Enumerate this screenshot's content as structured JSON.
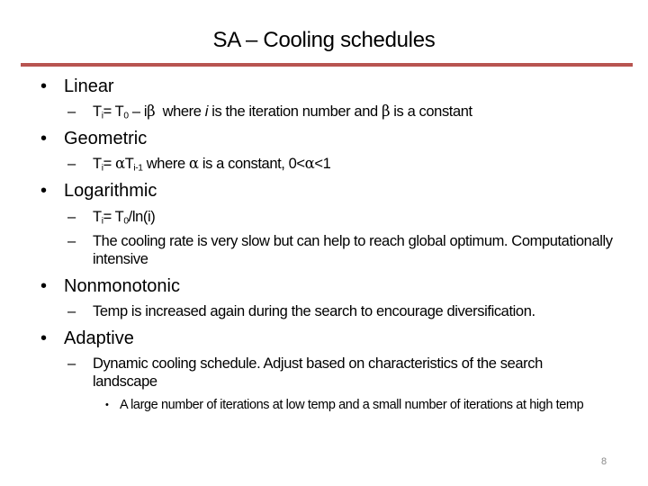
{
  "slide": {
    "title": "SA – Cooling schedules",
    "accent_color": "#b85450",
    "page_number": "8",
    "sections": [
      {
        "heading": "Linear",
        "bullet": "•",
        "items": [
          {
            "dash": "–",
            "formula": {
              "lhs": "T",
              "lhs_sub": "i",
              "eq": "= T",
              "eq_sub": "0",
              "rest": " – i",
              "greek": "β"
            },
            "text_a": "  where ",
            "text_it": "i",
            "text_b": " is the iteration number and ",
            "text_greek": "β",
            "text_c": " is a constant"
          }
        ]
      },
      {
        "heading": "Geometric",
        "bullet": "•",
        "items": [
          {
            "dash": "–",
            "lhs": "T",
            "lhs_sub": "i",
            "eq": "= ",
            "greek": "α",
            "t": "T",
            "t_sub": "i-1",
            "text_a": " where ",
            "text_greek": "α",
            "text_b": " is a constant, 0<",
            "text_greek2": "α",
            "text_c": "<1"
          }
        ]
      },
      {
        "heading": "Logarithmic",
        "bullet": "•",
        "items": [
          {
            "dash": "–",
            "lhs": "T",
            "lhs_sub": "i",
            "eq": "= T",
            "eq_sub": "0",
            "rest": "/ln(i)"
          },
          {
            "dash": "–",
            "text": "The cooling rate is very slow but can help to reach global optimum. Computationally intensive"
          }
        ]
      },
      {
        "heading": "Nonmonotonic",
        "bullet": "•",
        "items": [
          {
            "dash": "–",
            "text": "Temp is increased again during the search to encourage diversification."
          }
        ]
      },
      {
        "heading": "Adaptive",
        "bullet": "•",
        "items": [
          {
            "dash": "–",
            "text": "Dynamic cooling schedule. Adjust based on characteristics of the search landscape"
          }
        ],
        "subitems": [
          {
            "bullet": "•",
            "text": "A large number of iterations at low temp and a small number of iterations at high temp"
          }
        ]
      }
    ]
  }
}
